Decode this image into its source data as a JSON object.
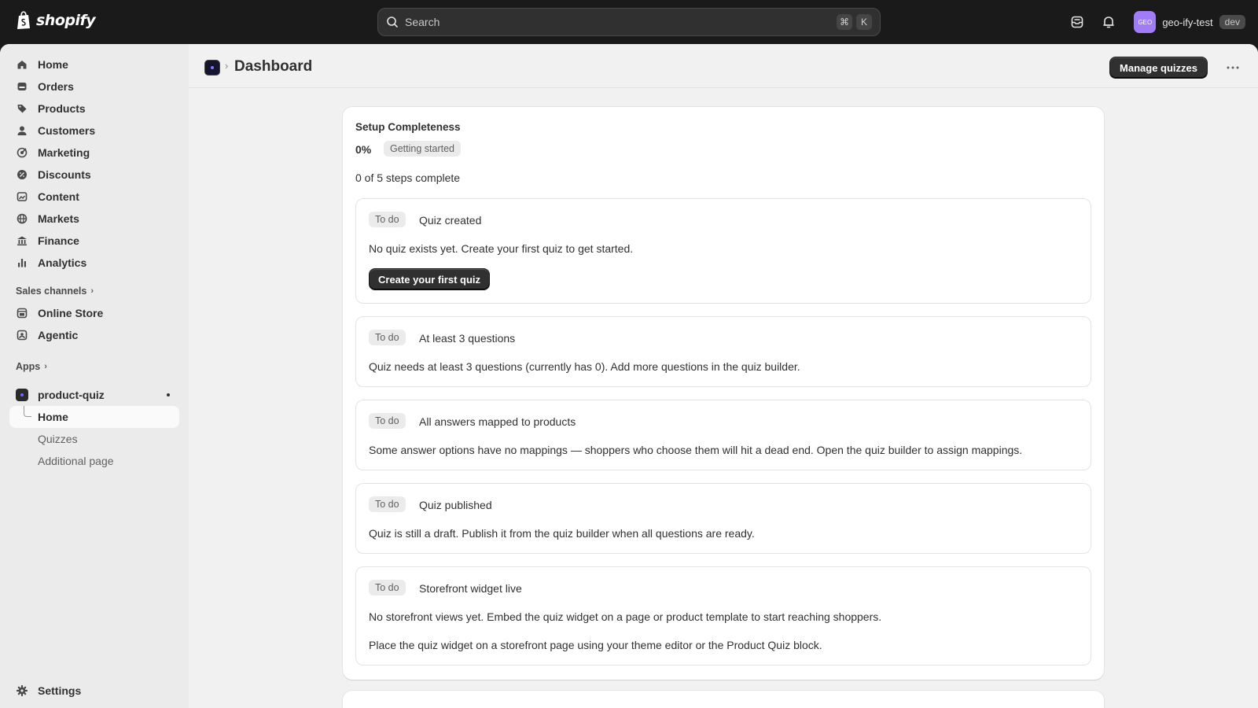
{
  "topbar": {
    "brand": "shopify",
    "search_placeholder": "Search",
    "shortcut_keys": [
      "⌘",
      "K"
    ],
    "avatar_initials": "GEO",
    "store_name": "geo-ify-test",
    "env_badge": "dev"
  },
  "sidebar": {
    "items": [
      {
        "label": "Home",
        "icon": "home-icon"
      },
      {
        "label": "Orders",
        "icon": "orders-icon"
      },
      {
        "label": "Products",
        "icon": "tag-icon"
      },
      {
        "label": "Customers",
        "icon": "person-icon"
      },
      {
        "label": "Marketing",
        "icon": "target-icon"
      },
      {
        "label": "Discounts",
        "icon": "discount-icon"
      },
      {
        "label": "Content",
        "icon": "content-icon"
      },
      {
        "label": "Markets",
        "icon": "globe-icon"
      },
      {
        "label": "Finance",
        "icon": "bank-icon"
      },
      {
        "label": "Analytics",
        "icon": "chart-icon"
      }
    ],
    "sales_channels_label": "Sales channels",
    "sales_channels": [
      {
        "label": "Online Store",
        "icon": "store-icon"
      },
      {
        "label": "Agentic",
        "icon": "agentic-icon"
      }
    ],
    "apps_label": "Apps",
    "app": {
      "name": "product-quiz",
      "subitems": [
        "Home",
        "Quizzes",
        "Additional page"
      ]
    },
    "settings_label": "Settings"
  },
  "header": {
    "title": "Dashboard",
    "primary_action": "Manage quizzes"
  },
  "setup": {
    "title": "Setup Completeness",
    "percent": "0%",
    "progress_fraction": 0,
    "status_badge": "Getting started",
    "steps_summary": "0 of 5 steps complete",
    "steps": [
      {
        "status": "To do",
        "title": "Quiz created",
        "description": "No quiz exists yet. Create your first quiz to get started.",
        "action": "Create your first quiz"
      },
      {
        "status": "To do",
        "title": "At least 3 questions",
        "description": "Quiz needs at least 3 questions (currently has 0). Add more questions in the quiz builder."
      },
      {
        "status": "To do",
        "title": "All answers mapped to products",
        "description": "Some answer options have no mappings — shoppers who choose them will hit a dead end. Open the quiz builder to assign mappings."
      },
      {
        "status": "To do",
        "title": "Quiz published",
        "description": "Quiz is still a draft. Publish it from the quiz builder when all questions are ready."
      },
      {
        "status": "To do",
        "title": "Storefront widget live",
        "description": "No storefront views yet. Embed the quiz widget on a page or product template to start reaching shoppers.",
        "note": "Place the quiz widget on a storefront page using your theme editor or the Product Quiz block."
      }
    ]
  }
}
